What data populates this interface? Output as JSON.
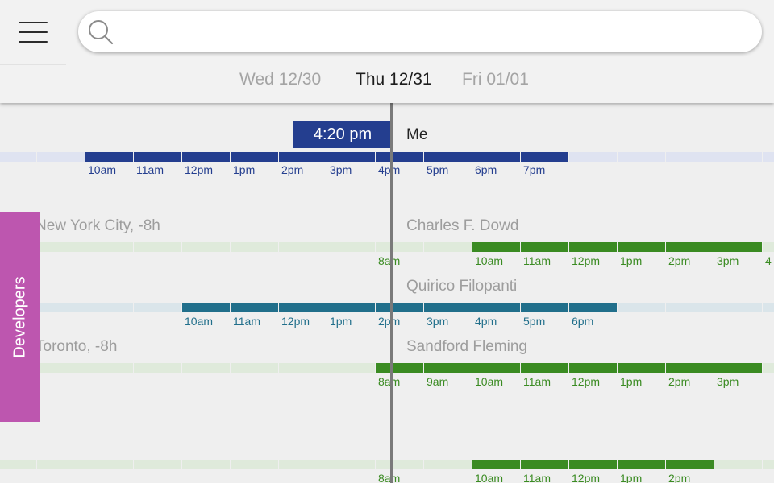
{
  "header": {
    "search_placeholder": "",
    "days": [
      {
        "label": "Wed 12/30",
        "active": false
      },
      {
        "label": "Thu 12/31",
        "active": true
      },
      {
        "label": "Fri 01/01",
        "active": false
      }
    ]
  },
  "now": {
    "time_label": "4:20 pm"
  },
  "group": {
    "label": "Developers"
  },
  "rows": [
    {
      "name": "Me",
      "city": "",
      "track_color": "#dfe3f1",
      "work_color": "#243e8f",
      "text_color": "#243e8f",
      "work_hours": "10am–7pm",
      "ticks": [
        "10am",
        "11am",
        "12pm",
        "1pm",
        "2pm",
        "3pm",
        "4pm",
        "5pm",
        "6pm",
        "7pm"
      ]
    },
    {
      "name": "Charles F. Dowd",
      "city": "New York City, -8h",
      "track_color": "#dfeadb",
      "work_color": "#3a8b22",
      "text_color": "#3a8b22",
      "work_hours": "10am–…",
      "ticks": [
        "8am",
        "10am",
        "11am",
        "12pm",
        "1pm",
        "2pm",
        "3pm",
        "4"
      ]
    },
    {
      "name": "Quirico Filopanti",
      "city": "",
      "track_color": "#dae5ea",
      "work_color": "#216f8b",
      "text_color": "#216f8b",
      "work_hours": "10am–6pm",
      "ticks": [
        "10am",
        "11am",
        "12pm",
        "1pm",
        "2pm",
        "3pm",
        "4pm",
        "5pm",
        "6pm"
      ]
    },
    {
      "name": "Sandford Fleming",
      "city": "Toronto, -8h",
      "track_color": "#dfeadb",
      "work_color": "#3a8b22",
      "text_color": "#3a8b22",
      "work_hours": "8am–…",
      "ticks": [
        "8am",
        "9am",
        "10am",
        "11am",
        "12pm",
        "1pm",
        "2pm",
        "3pm"
      ]
    },
    {
      "name": "",
      "city": "",
      "track_color": "#dfeadb",
      "work_color": "#3a8b22",
      "text_color": "#3a8b22",
      "work_hours": "10am–2pm",
      "ticks": [
        "8am",
        "10am",
        "11am",
        "12pm",
        "1pm",
        "2pm"
      ]
    }
  ],
  "colors": {
    "header_bg": "#f2f2f2",
    "page_bg": "#efefef",
    "now_badge": "#243e8f",
    "now_line": "#7a7a7a",
    "group_tab": "#bd56af"
  }
}
